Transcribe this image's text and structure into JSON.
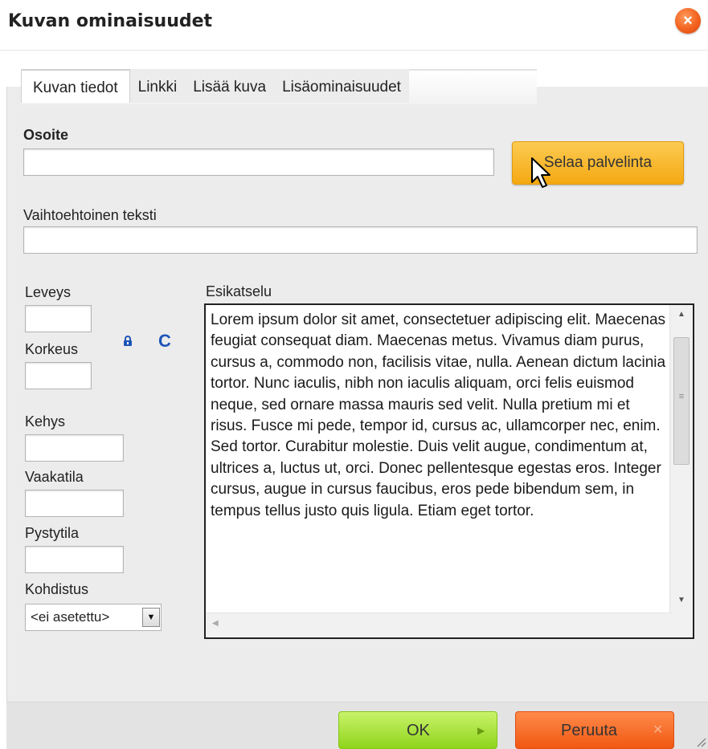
{
  "dialog": {
    "title": "Kuvan ominaisuudet",
    "close_icon": "×"
  },
  "tabs": [
    {
      "label": "Kuvan tiedot",
      "active": true
    },
    {
      "label": "Linkki",
      "active": false
    },
    {
      "label": "Lisää kuva",
      "active": false
    },
    {
      "label": "Lisäominaisuudet",
      "active": false
    }
  ],
  "form": {
    "url_label": "Osoite",
    "url_value": "",
    "browse_label": "Selaa palvelinta",
    "alt_label": "Vaihtoehtoinen teksti",
    "alt_value": "",
    "width_label": "Leveys",
    "width_value": "",
    "height_label": "Korkeus",
    "height_value": "",
    "border_label": "Kehys",
    "border_value": "",
    "hspace_label": "Vaakatila",
    "hspace_value": "",
    "vspace_label": "Pystytila",
    "vspace_value": "",
    "align_label": "Kohdistus",
    "align_value": "<ei asetettu>",
    "lock_icon": "lock-icon",
    "reset_icon": "reset-size-icon",
    "reset_glyph": "C"
  },
  "preview": {
    "label": "Esikatselu",
    "text": "Lorem ipsum dolor sit amet, consectetuer adipiscing elit. Maecenas feugiat consequat diam. Maecenas metus. Vivamus diam purus, cursus a, commodo non, facilisis vitae, nulla. Aenean dictum lacinia tortor. Nunc iaculis, nibh non iaculis aliquam, orci felis euismod neque, sed ornare massa mauris sed velit. Nulla pretium mi et risus. Fusce mi pede, tempor id, cursus ac, ullamcorper nec, enim. Sed tortor. Curabitur molestie. Duis velit augue, condimentum at, ultrices a, luctus ut, orci. Donec pellentesque egestas eros. Integer cursus, augue in cursus faucibus, eros pede bibendum sem, in tempus tellus justo quis ligula. Etiam eget tortor."
  },
  "footer": {
    "ok_label": "OK",
    "cancel_label": "Peruuta"
  },
  "colors": {
    "browse_button": "#f4a812",
    "ok_button": "#8fd41b",
    "cancel_button": "#f05812",
    "close_button": "#f2621e"
  }
}
